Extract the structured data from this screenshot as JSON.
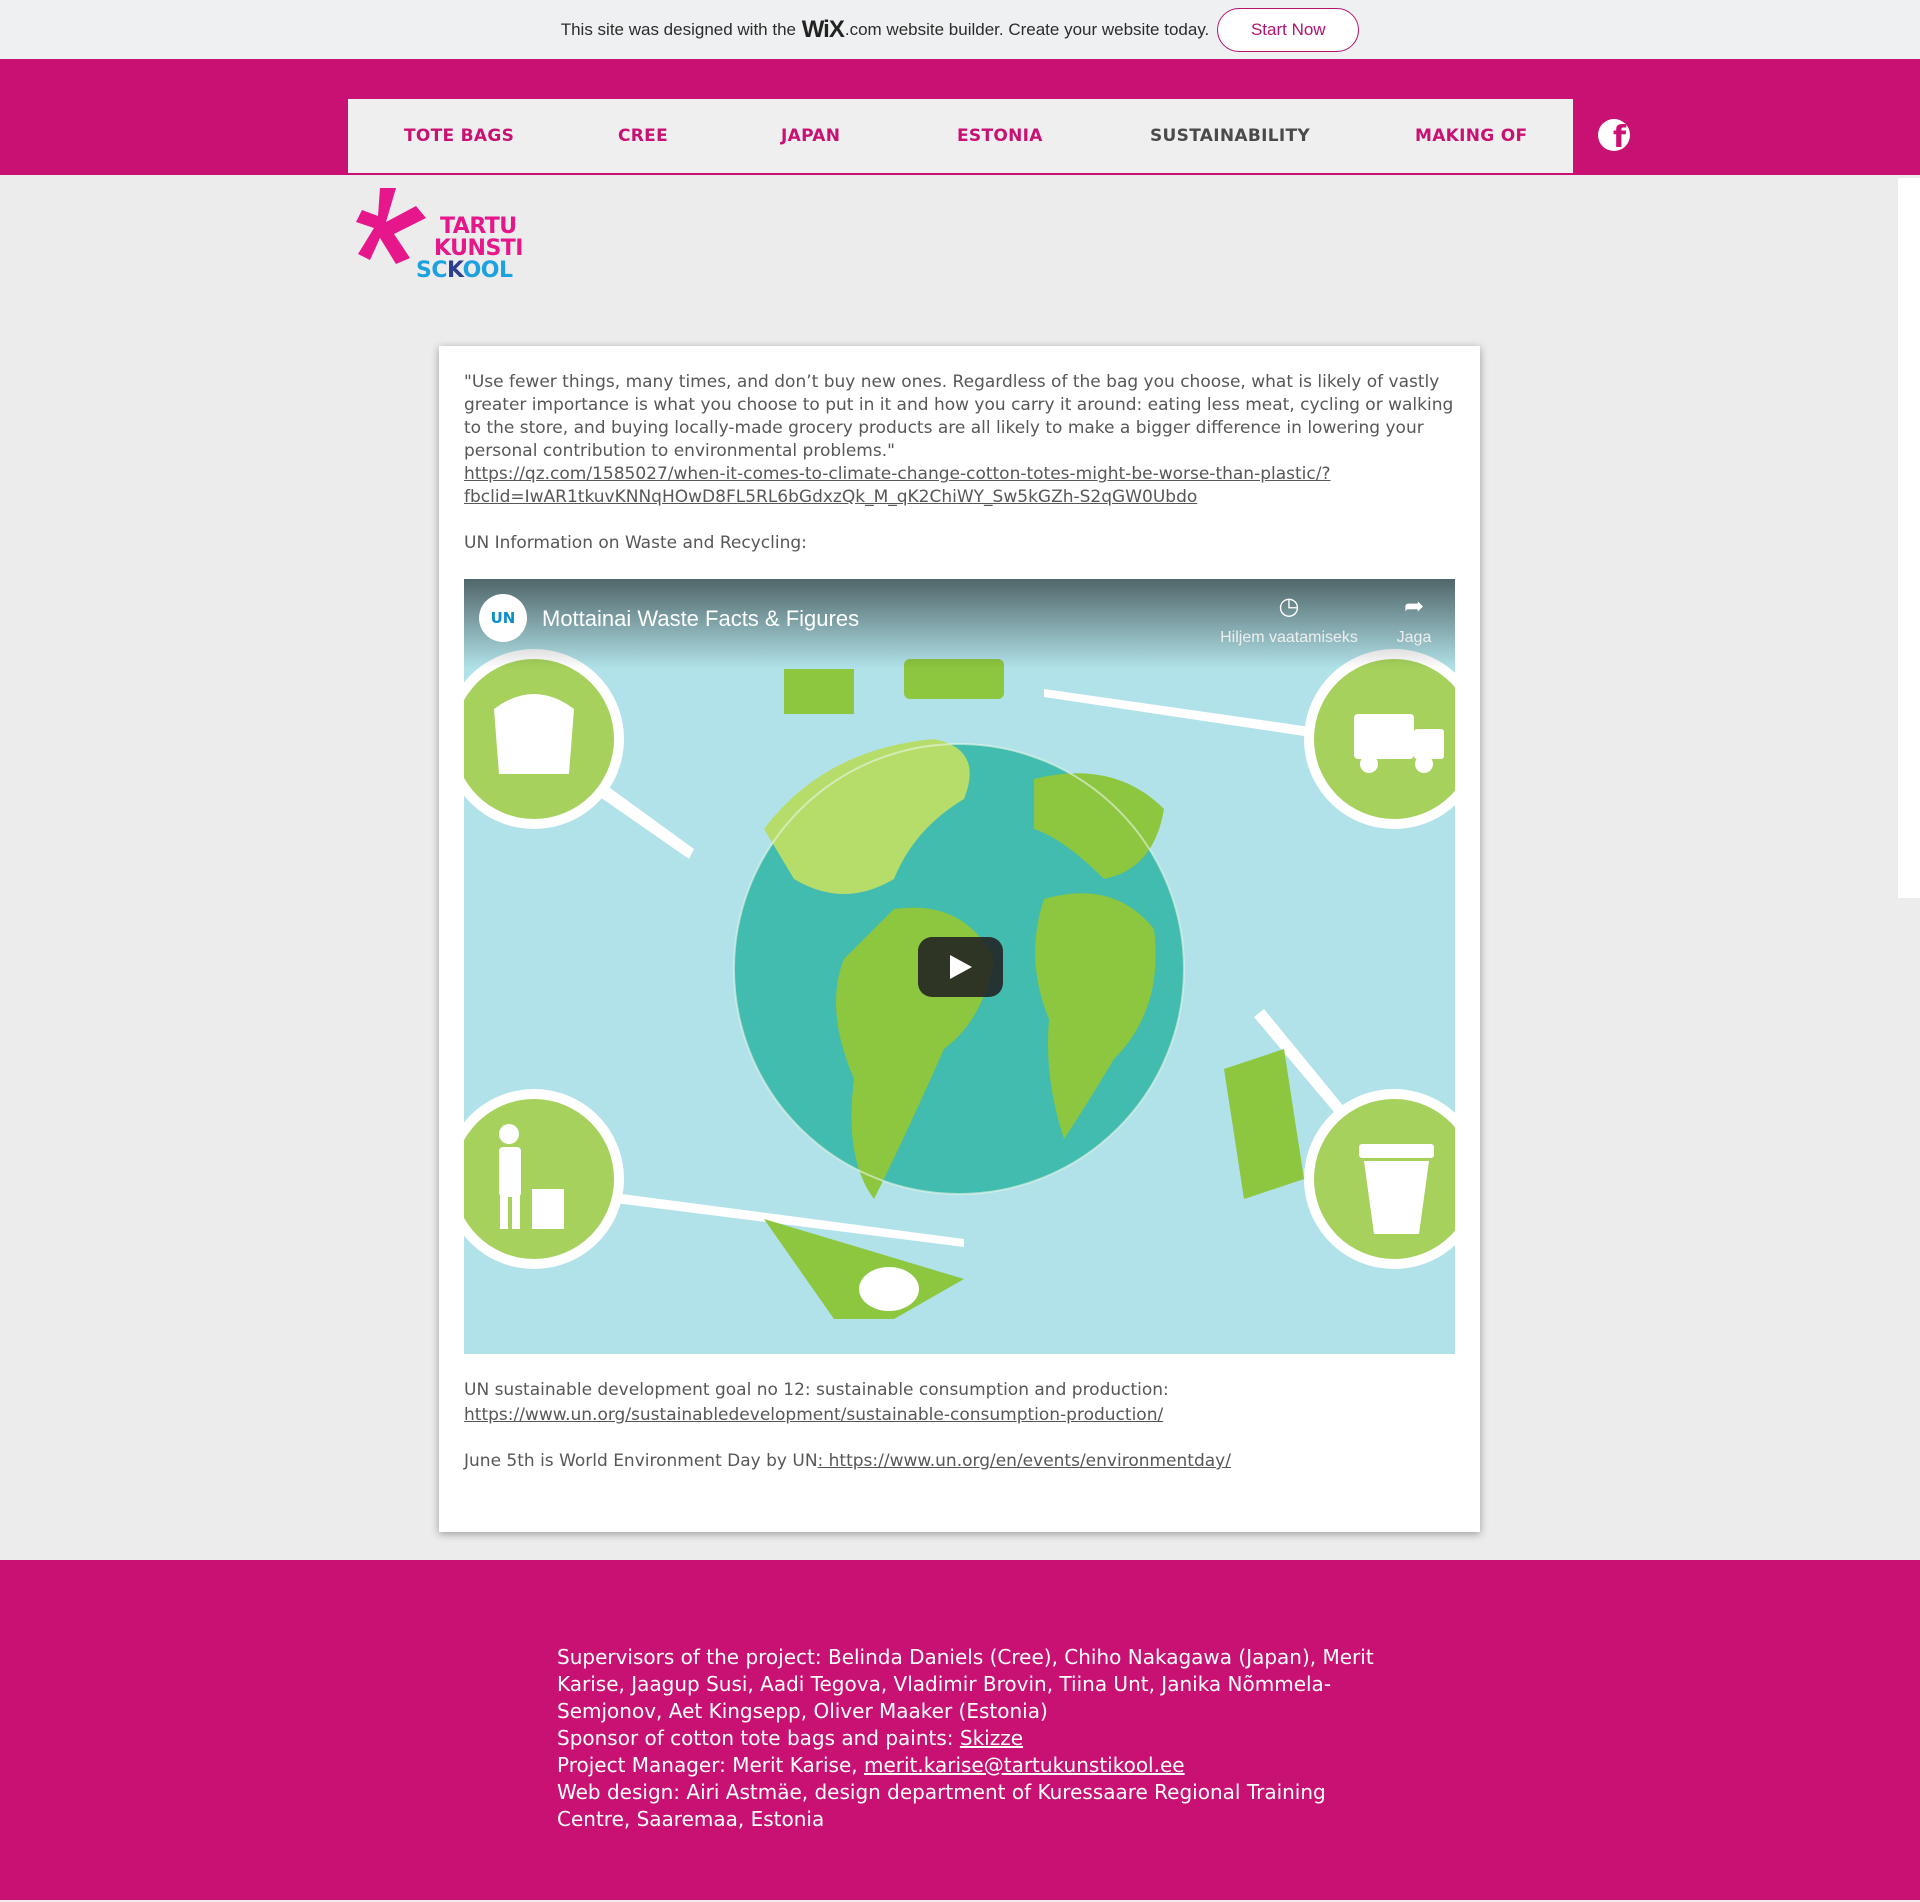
{
  "wix_banner": {
    "text_before": "This site was designed with the",
    "logo": "WiX",
    "text_after": ".com website builder. Create your website today.",
    "button_label": "Start Now"
  },
  "nav": {
    "items": [
      {
        "label": "TOTE BAGS",
        "active": false
      },
      {
        "label": "CREE",
        "active": false
      },
      {
        "label": "JAPAN",
        "active": false
      },
      {
        "label": "ESTONIA",
        "active": false
      },
      {
        "label": "SUSTAINABILITY",
        "active": true
      },
      {
        "label": "MAKING OF",
        "active": false
      }
    ],
    "social_icon": "facebook-icon"
  },
  "logo": {
    "line1": "TARTU",
    "line2": "KUNSTI",
    "line3_a": "SC",
    "line3_b": "K",
    "line3_c": "OOL"
  },
  "content": {
    "quote": "\"Use fewer things, many times, and don’t buy new ones. Regardless of the bag you choose, what is likely of vastly greater importance is what you choose to put in it and how you carry it around: eating less meat, cycling or walking to the store, and buying locally-made grocery products are all likely to make a bigger difference in lowering your personal contribution to environmental problems.\"",
    "quote_link_1": "https://qz.com/1585027/when-it-comes-to-climate-change-cotton-totes-might-be-worse-than-plastic/?",
    "quote_link_2": "fbclid=IwAR1tkuvKNNqHOwD8FL5RL6bGdxzQk_M_qK2ChiWY_Sw5kGZh-S2qGW0Ubdo",
    "un_waste_label": "UN Information on Waste and Recycling:",
    "video": {
      "channel_logo": "UN",
      "title": "Mottainai Waste Facts & Figures",
      "watch_later": "Hiljem vaatamiseks",
      "share": "Jaga"
    },
    "sdg_label": "UN sustainable development goal no 12: sustainable consumption and production:",
    "sdg_link": "https://www.un.org/sustainabledevelopment/sustainable-consumption-production/",
    "env_day_label": "June 5th is World Environment Day by UN",
    "env_day_link": ": https://www.un.org/en/events/environmentday/"
  },
  "footer": {
    "supervisors": "Supervisors of the project: Belinda Daniels (Cree), Chiho Nakagawa (Japan), Merit Karise, Jaagup Susi, Aadi Tegova, Vladimir Brovin, Tiina Unt, Janika Nõmmela-Semjonov, Aet Kingsepp, Oliver Maaker (Estonia)",
    "sponsor_label": "Sponsor of cotton tote bags and paints: ",
    "sponsor_link": "Skizze",
    "pm_label": "Project Manager: Merit Karise, ",
    "pm_email": "merit.karise@tartukunstikool.ee",
    "web_design": "Web design: Airi Astmäe, design department of Kuressaare Regional Training Centre, Saaremaa, Estonia"
  }
}
